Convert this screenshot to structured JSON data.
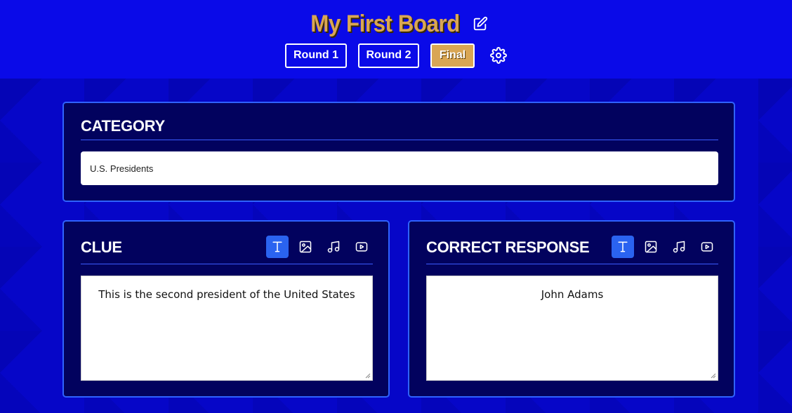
{
  "header": {
    "title": "My First Board",
    "rounds": [
      {
        "label": "Round 1",
        "active": false
      },
      {
        "label": "Round 2",
        "active": false
      },
      {
        "label": "Final",
        "active": true
      }
    ]
  },
  "category": {
    "heading": "CATEGORY",
    "value": "U.S. Presidents"
  },
  "clue": {
    "heading": "CLUE",
    "text": "This is the second president of the United States",
    "active_mode": "text"
  },
  "response": {
    "heading": "CORRECT RESPONSE",
    "text": "John Adams",
    "active_mode": "text"
  },
  "icons": {
    "edit": "edit-icon",
    "settings": "gear-icon",
    "text": "text-format-icon",
    "image": "image-icon",
    "audio": "music-note-icon",
    "video": "video-play-icon"
  },
  "colors": {
    "header_bg": "#0a0ae8",
    "title": "#d9a654",
    "panel_bg": "#02025e",
    "panel_border": "#2f62ff",
    "active_tool": "#2a63f0"
  }
}
